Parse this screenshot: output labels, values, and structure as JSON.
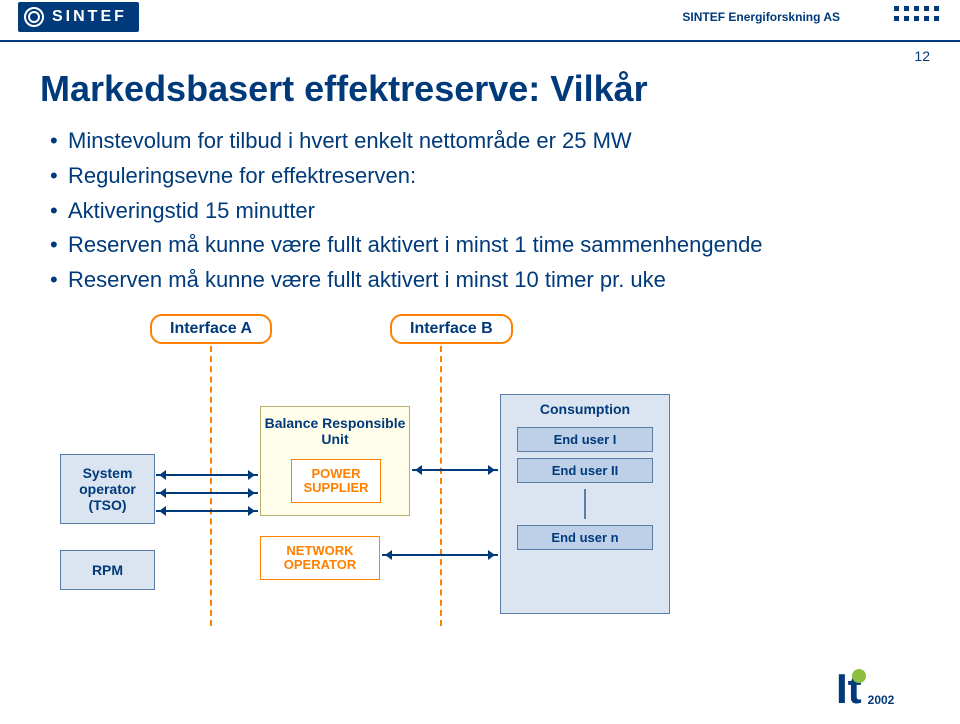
{
  "page_number": "12",
  "header": {
    "logo_text": "SINTEF",
    "org": "SINTEF Energiforskning AS"
  },
  "title": "Markedsbasert effektreserve: Vilkår",
  "bullets": [
    "Minstevolum for tilbud i hvert enkelt nettområde er 25 MW",
    "Reguleringsevne for effektreserven:",
    "Aktiveringstid 15 minutter",
    "Reserven må kunne være fullt aktivert i minst 1 time sammenhengende",
    "Reserven må kunne være fullt aktivert i minst 10 timer pr. uke"
  ],
  "diagram": {
    "interface_a": "Interface A",
    "interface_b": "Interface B",
    "tso": "System operator (TSO)",
    "rpm": "RPM",
    "bru": "Balance Responsible  Unit",
    "supplier": "POWER SUPPLIER",
    "network": "NETWORK OPERATOR",
    "consumption": "Consumption",
    "end_users": [
      "End user I",
      "End user II",
      "End user n"
    ]
  },
  "event": {
    "it": "It",
    "year": "2002"
  }
}
